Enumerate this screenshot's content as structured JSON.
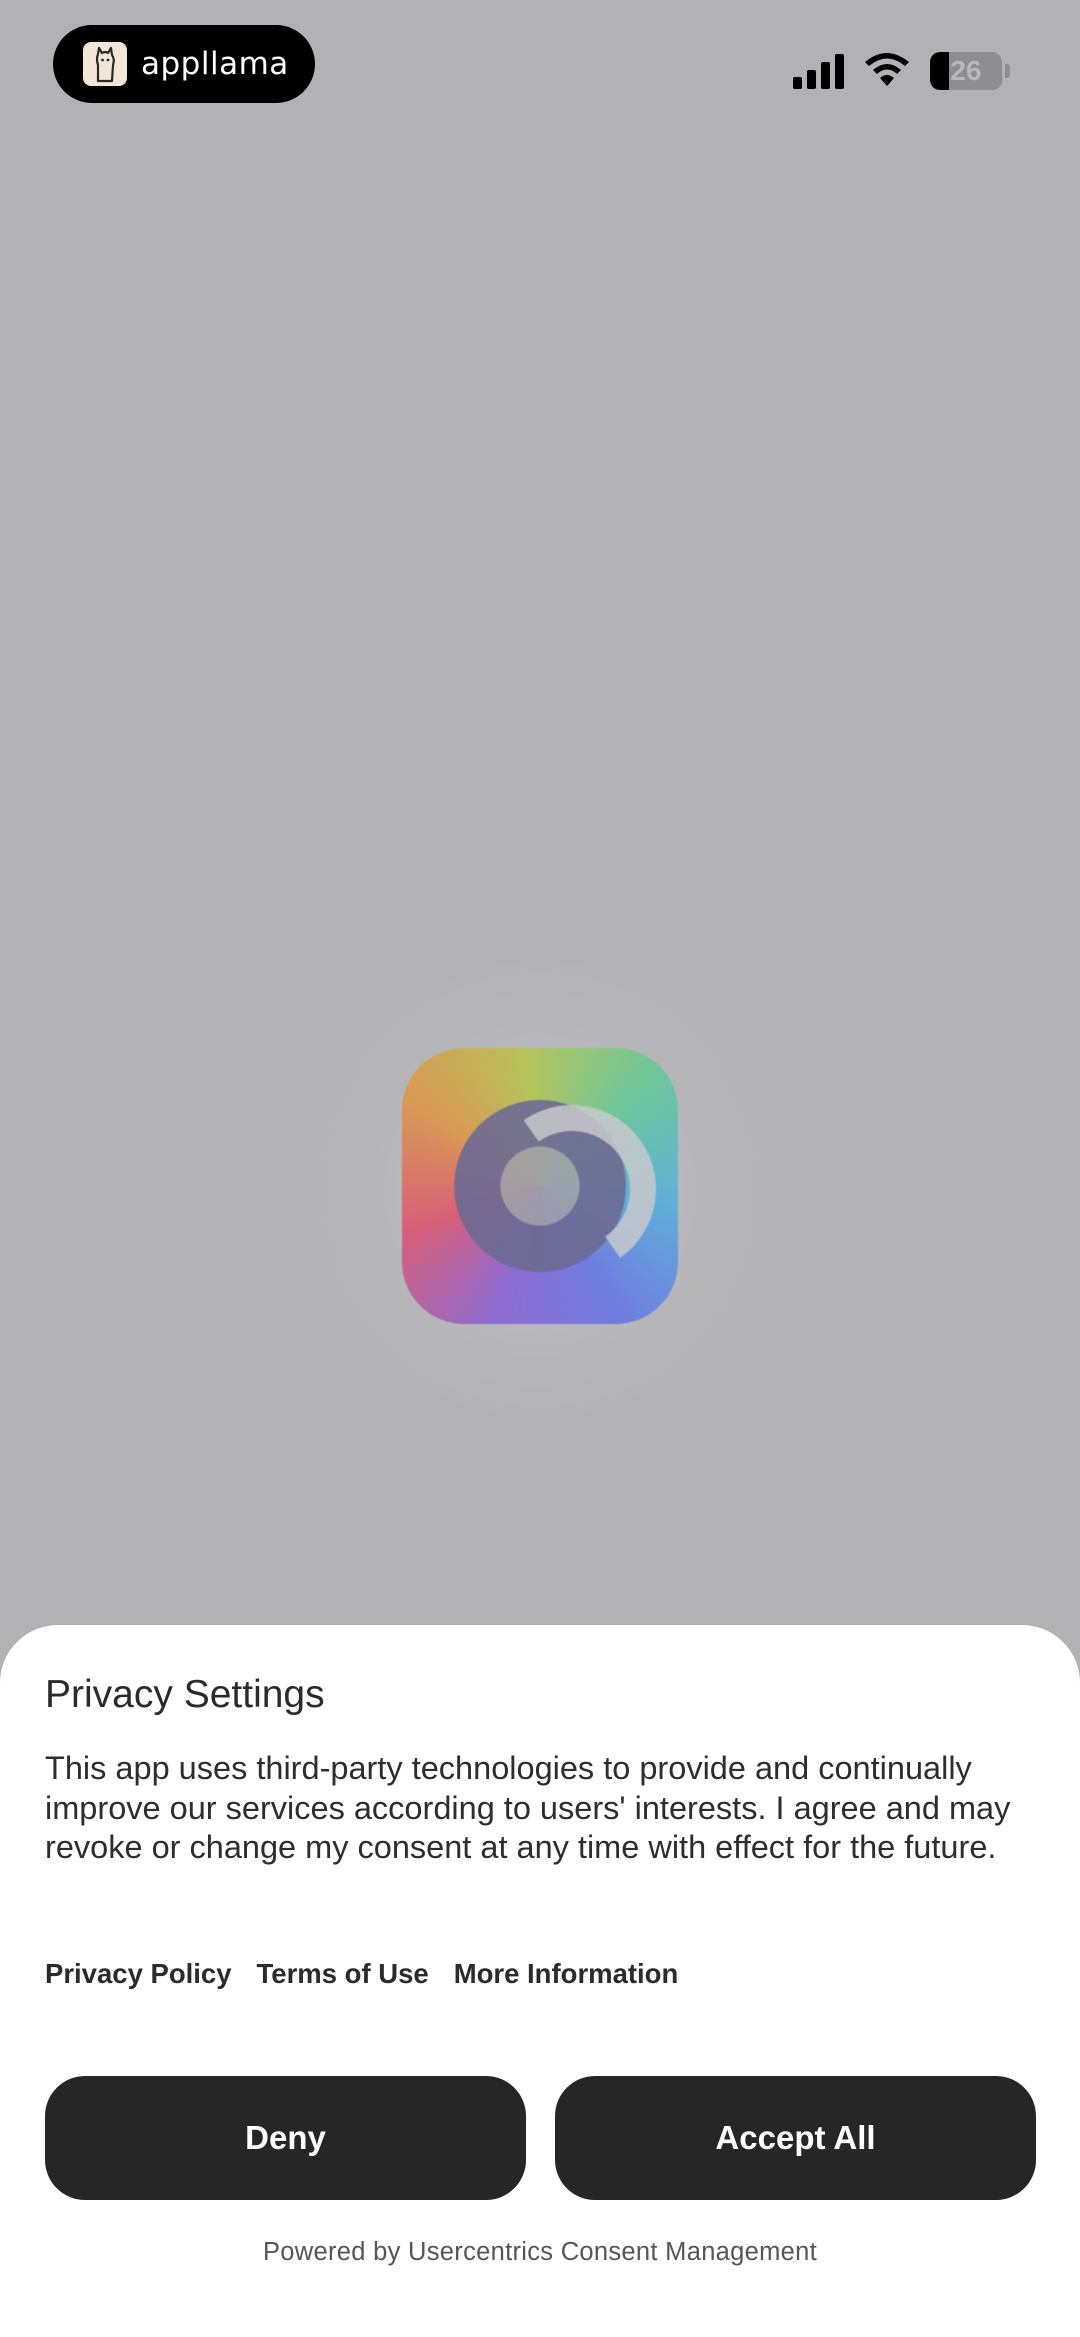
{
  "status_bar": {
    "brand_name": "appllama",
    "battery_level": "26",
    "battery_fraction": 0.26,
    "signal_icon": "cellular-signal-icon",
    "wifi_icon": "wifi-icon"
  },
  "app": {
    "icon": "app-logo-icon"
  },
  "privacy": {
    "title": "Privacy Settings",
    "body": "This app uses third-party technologies to provide and continually improve our services according to users' interests. I agree and may revoke or change my consent at any time with effect for the future.",
    "links": {
      "privacy_policy": "Privacy Policy",
      "terms_of_use": "Terms of Use",
      "more_information": "More Information"
    },
    "buttons": {
      "deny": "Deny",
      "accept_all": "Accept All"
    },
    "powered_by": "Powered by Usercentrics Consent Management"
  },
  "colors": {
    "backdrop": "#b2b2b4",
    "sheet": "#ffffff",
    "button": "#262626"
  }
}
